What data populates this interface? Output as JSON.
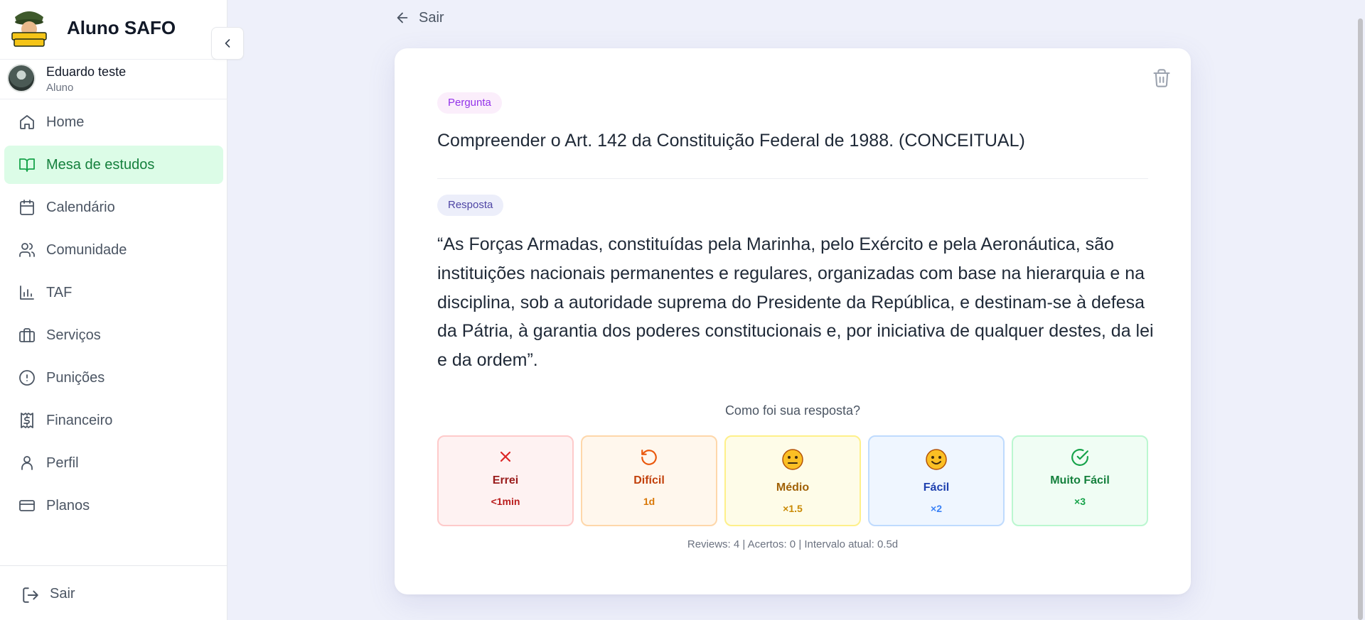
{
  "app": {
    "title": "Aluno SAFO",
    "logo_text": "ALUNO SAFO"
  },
  "user": {
    "name": "Eduardo teste",
    "role": "Aluno"
  },
  "sidebar": {
    "items": [
      {
        "label": "Home",
        "icon": "home-icon",
        "active": false
      },
      {
        "label": "Mesa de estudos",
        "icon": "book-open-icon",
        "active": true
      },
      {
        "label": "Calendário",
        "icon": "calendar-icon",
        "active": false
      },
      {
        "label": "Comunidade",
        "icon": "users-icon",
        "active": false
      },
      {
        "label": "TAF",
        "icon": "bar-chart-icon",
        "active": false
      },
      {
        "label": "Serviços",
        "icon": "briefcase-icon",
        "active": false
      },
      {
        "label": "Punições",
        "icon": "alert-circle-icon",
        "active": false
      },
      {
        "label": "Financeiro",
        "icon": "receipt-dollar-icon",
        "active": false
      },
      {
        "label": "Perfil",
        "icon": "user-icon",
        "active": false
      },
      {
        "label": "Planos",
        "icon": "credit-card-icon",
        "active": false
      }
    ],
    "logout_label": "Sair"
  },
  "main": {
    "back_label": "Sair",
    "card": {
      "question_badge": "Pergunta",
      "question": "Compreender o Art. 142 da Constituição Federal de 1988. (CONCEITUAL)",
      "answer_badge": "Resposta",
      "answer": "“As Forças Armadas, constituídas pela Marinha, pelo Exército e pela Aeronáutica, são instituições nacionais permanentes e regulares, organizadas com base na hierarquia e na disciplina, sob a autoridade suprema do Presidente da República, e destinam-se à defesa da Pátria, à garantia dos poderes constitucionais e, por iniciativa de qualquer destes, da lei e da ordem”.",
      "rating_prompt": "Como foi sua resposta?",
      "options": [
        {
          "label": "Errei",
          "value": "<1min",
          "icon": "x-icon",
          "text_color": "#991b1b",
          "value_color": "#b91c1c",
          "bg": "#fef2f2",
          "border": "#fecaca"
        },
        {
          "label": "Difícil",
          "value": "1d",
          "icon": "rotate-ccw-icon",
          "text_color": "#c2410c",
          "value_color": "#d97706",
          "bg": "#fff7ed",
          "border": "#fed7aa"
        },
        {
          "label": "Médio",
          "value": "×1.5",
          "icon": "neutral-face-icon",
          "glyph": "😐",
          "text_color": "#a16207",
          "value_color": "#ca8a04",
          "bg": "#fefce8",
          "border": "#fef08a"
        },
        {
          "label": "Fácil",
          "value": "×2",
          "icon": "smile-face-icon",
          "glyph": "🙂",
          "text_color": "#1e40af",
          "value_color": "#3b82f6",
          "bg": "#eff6ff",
          "border": "#bfdbfe"
        },
        {
          "label": "Muito Fácil",
          "value": "×3",
          "icon": "check-circle-icon",
          "text_color": "#15803d",
          "value_color": "#16a34a",
          "bg": "#f0fdf4",
          "border": "#bbf7d0"
        }
      ],
      "stats": "Reviews: 4 | Acertos: 0 | Intervalo atual: 0.5d"
    }
  }
}
